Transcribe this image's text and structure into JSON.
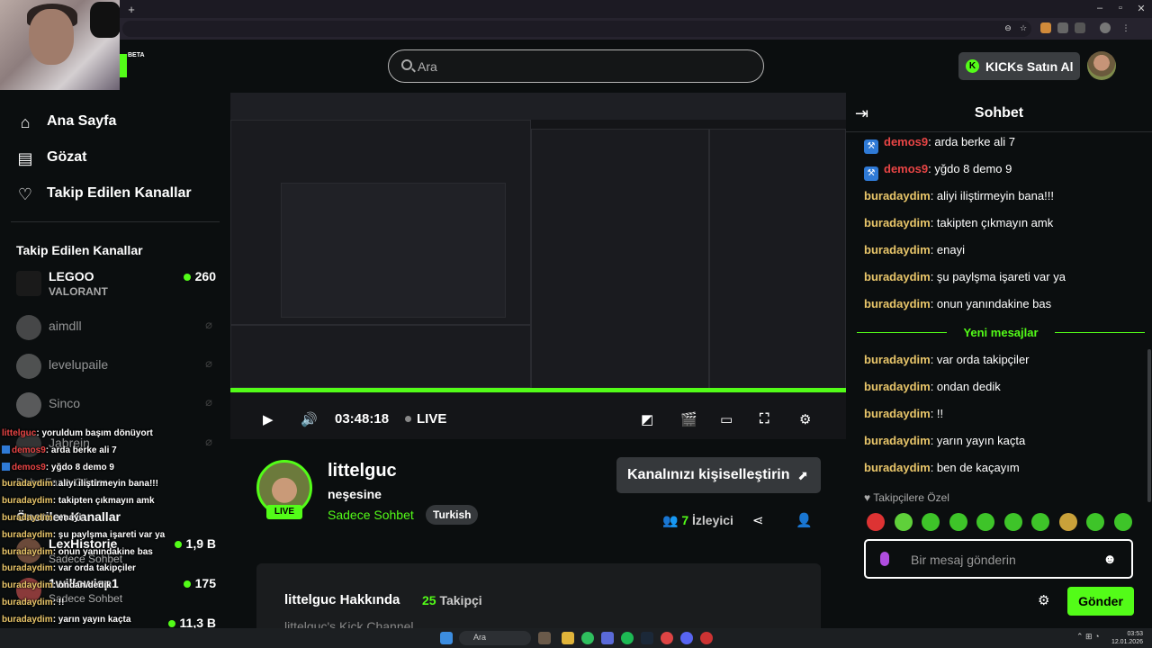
{
  "search": {
    "placeholder": "Ara"
  },
  "header": {
    "kicks_label": "KICKs Satın Al",
    "beta": "BETA"
  },
  "sidebar": {
    "nav": [
      {
        "label": "Ana Sayfa",
        "icon": "home-icon"
      },
      {
        "label": "Gözat",
        "icon": "browse-icon"
      },
      {
        "label": "Takip Edilen Kanallar",
        "icon": "heart-icon"
      }
    ],
    "followed_title": "Takip Edilen Kanallar",
    "followed": [
      {
        "name": "LEGOO",
        "sub": "VALORANT",
        "viewers": "260",
        "live": true
      },
      {
        "name": "aimdll",
        "live": false
      },
      {
        "name": "levelupaile",
        "live": false
      },
      {
        "name": "Sinco",
        "live": false
      },
      {
        "name": "Jabrein",
        "live": false
      }
    ],
    "show_more": "Daha Fazla Göster",
    "recommended_title": "Önerilen Kanallar",
    "recommended": [
      {
        "name": "LexHistorie",
        "sub": "Sadece Sohbet",
        "viewers": "1,9 B"
      },
      {
        "name": "1willowisp1",
        "sub": "Sadece Sohbet",
        "viewers": "175"
      },
      {
        "name": "",
        "sub": "",
        "viewers": "11,3 B"
      }
    ]
  },
  "overlay_chat": [
    {
      "user": "littelguc",
      "text": ": yoruldum başım dönüyort",
      "red": true,
      "badge": false
    },
    {
      "user": "demos9",
      "text": ": arda berke ali 7",
      "red": true,
      "badge": true
    },
    {
      "user": "demos9",
      "text": ": yğdo 8 demo 9",
      "red": true,
      "badge": true
    },
    {
      "user": "buradaydim",
      "text": ": aliyi iliştirmeyin bana!!!",
      "red": false,
      "badge": false
    },
    {
      "user": "buradaydim",
      "text": ": takipten çıkmayın amk",
      "red": false,
      "badge": false
    },
    {
      "user": "buradaydim",
      "text": ": enayi",
      "red": false,
      "badge": false
    },
    {
      "user": "buradaydim",
      "text": ": şu paylşma işareti var ya",
      "red": false,
      "badge": false
    },
    {
      "user": "buradaydim",
      "text": ": onun yanındakine bas",
      "red": false,
      "badge": false
    },
    {
      "user": "buradaydim",
      "text": ": var orda takipçiler",
      "red": false,
      "badge": false
    },
    {
      "user": "buradaydim",
      "text": ": ondan dedik",
      "red": false,
      "badge": false
    },
    {
      "user": "buradaydim",
      "text": ": !!",
      "red": false,
      "badge": false
    },
    {
      "user": "buradaydim",
      "text": ": yarın yayın kaçta",
      "red": false,
      "badge": false
    },
    {
      "user": "buradaydim",
      "text": ": ben de kaçayım",
      "red": false,
      "badge": false
    }
  ],
  "player": {
    "time": "03:48:18",
    "live_label": "LIVE"
  },
  "channel": {
    "name": "littelguc",
    "title": "neşesine",
    "category": "Sadece Sohbet",
    "tag": "Turkish",
    "live_badge": "LIVE",
    "customize_label": "Kanalınızı kişiselleştirin",
    "viewers_count": "7",
    "viewers_label": "İzleyici",
    "about_title": "littelguc Hakkında",
    "followers_count": "25",
    "followers_label": "Takipçi",
    "about_text": "littelguc's Kick Channel"
  },
  "chat": {
    "title": "Sohbet",
    "messages": [
      {
        "user": "demos9",
        "text": ": arda berke ali 7",
        "red": true,
        "badge": true
      },
      {
        "user": "demos9",
        "text": ": yğdo 8 demo 9",
        "red": true,
        "badge": true
      },
      {
        "user": "buradaydim",
        "text": ": aliyi iliştirmeyin bana!!!",
        "red": false,
        "badge": false
      },
      {
        "user": "buradaydim",
        "text": ": takipten çıkmayın amk",
        "red": false,
        "badge": false
      },
      {
        "user": "buradaydim",
        "text": ": enayi",
        "red": false,
        "badge": false
      },
      {
        "user": "buradaydim",
        "text": ": şu paylşma işareti var ya",
        "red": false,
        "badge": false
      },
      {
        "user": "buradaydim",
        "text": ": onun yanındakine bas",
        "red": false,
        "badge": false
      }
    ],
    "new_messages_label": "Yeni mesajlar",
    "new_messages": [
      {
        "user": "buradaydim",
        "text": ": var orda takipçiler"
      },
      {
        "user": "buradaydim",
        "text": ": ondan dedik"
      },
      {
        "user": "buradaydim",
        "text": ": !!"
      },
      {
        "user": "buradaydim",
        "text": ": yarın yayın kaçta"
      },
      {
        "user": "buradaydim",
        "text": ": ben de kaçayım"
      }
    ],
    "subscriber_label": "Takipçilere Özel",
    "input_placeholder": "Bir mesaj gönderin",
    "send_label": "Gönder"
  },
  "taskbar": {
    "search_placeholder": "Ara",
    "time": "03:53",
    "date": "12.01.2026"
  },
  "colors": {
    "accent": "#53fc18",
    "username": "#e9c66a",
    "red_user": "#e84545",
    "badge": "#2f7ad6",
    "background": "#0b0e0f"
  }
}
